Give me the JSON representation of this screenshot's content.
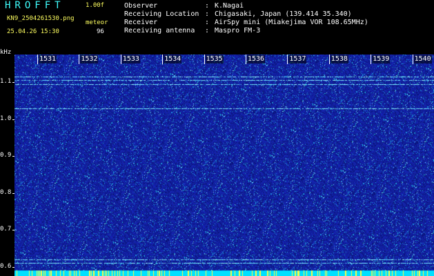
{
  "app": {
    "title": "HROFFT",
    "version": "1.00f",
    "file_name": "KN9_2504261530.png",
    "datetime": "25.04.26 15:30",
    "meteor_label": "meteor",
    "meteor_count": "96"
  },
  "info": [
    {
      "label": "Observer",
      "value": "K.Nagai"
    },
    {
      "label": "Receiving Location",
      "value": "Chigasaki, Japan (139.414 35.340)"
    },
    {
      "label": "Receiver",
      "value": "AirSpy mini (Miakejima VOR 108.65MHz)"
    },
    {
      "label": "Receiving antenna",
      "value": "Maspro FM-3"
    }
  ],
  "axis": {
    "unit": "kHz",
    "ticks": [
      "1.1",
      "1.0",
      "0.9",
      "0.8",
      "0.7",
      "0.6"
    ],
    "tick_values": [
      1.1,
      1.0,
      0.9,
      0.8,
      0.7,
      0.6
    ],
    "range": [
      0.575,
      1.175
    ]
  },
  "time_markers": [
    "1531",
    "1532",
    "1533",
    "1534",
    "1535",
    "1536",
    "1537",
    "1538",
    "1539",
    "1540"
  ],
  "colors": {
    "background": "#000000",
    "spectrogram_base": "#1a2aa0",
    "header_title": "#40ffff",
    "header_yellow": "#ffff60",
    "signal_line": "#60e0ff",
    "bottom_bar_cyan": "#00e0ff",
    "bottom_bar_yellow": "#ffff40"
  },
  "carrier_lines_khz": [
    1.115,
    1.105,
    1.095,
    1.03,
    0.62,
    0.61
  ]
}
